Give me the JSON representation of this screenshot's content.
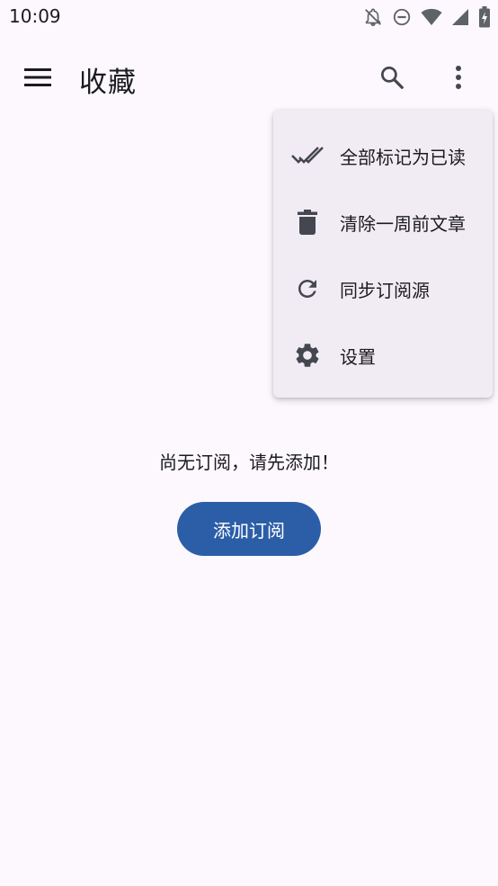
{
  "status_bar": {
    "time": "10:09",
    "icons": [
      "notifications-off-icon",
      "do-not-disturb-icon",
      "wifi-icon",
      "signal-icon",
      "battery-charging-icon"
    ]
  },
  "app_bar": {
    "title": "收藏",
    "icons": {
      "menu": "menu-icon",
      "search": "search-icon",
      "overflow": "more-vert-icon"
    }
  },
  "dropdown_menu": {
    "items": [
      {
        "label": "全部标记为已读",
        "icon": "done-all-icon"
      },
      {
        "label": "清除一周前文章",
        "icon": "delete-icon"
      },
      {
        "label": "同步订阅源",
        "icon": "refresh-icon"
      },
      {
        "label": "设置",
        "icon": "settings-icon"
      }
    ]
  },
  "empty_state": {
    "message": "尚无订阅，请先添加！",
    "button_label": "添加订阅"
  },
  "colors": {
    "background": "#FCF8FD",
    "primary_button": "#2C5EA8",
    "menu_surface": "#F1ECF4",
    "on_surface": "#1B1B1F",
    "icon": "#44474F"
  }
}
